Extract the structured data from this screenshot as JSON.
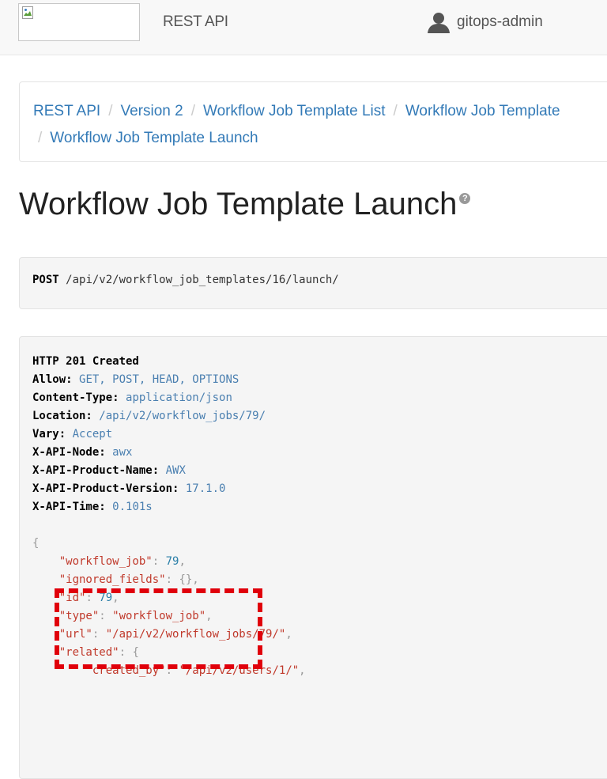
{
  "navbar": {
    "brand": "REST API",
    "username": "gitops-admin"
  },
  "breadcrumb": {
    "items": [
      "REST API",
      "Version 2",
      "Workflow Job Template List",
      "Workflow Job Template",
      "Workflow Job Template Launch"
    ]
  },
  "page": {
    "title": "Workflow Job Template Launch",
    "help_glyph": "?"
  },
  "request": {
    "method": "POST",
    "path": "/api/v2/workflow_job_templates/16/launch/"
  },
  "response": {
    "status": "HTTP 201 Created",
    "headers": [
      {
        "name": "Allow:",
        "value": "GET, POST, HEAD, OPTIONS"
      },
      {
        "name": "Content-Type:",
        "value": "application/json"
      },
      {
        "name": "Location:",
        "value": "/api/v2/workflow_jobs/79/"
      },
      {
        "name": "Vary:",
        "value": "Accept"
      },
      {
        "name": "X-API-Node:",
        "value": "awx"
      },
      {
        "name": "X-API-Product-Name:",
        "value": "AWX"
      },
      {
        "name": "X-API-Product-Version:",
        "value": "17.1.0"
      },
      {
        "name": "X-API-Time:",
        "value": "0.101s"
      }
    ],
    "body": {
      "open_brace": "{",
      "fields": [
        {
          "key": "\"workflow_job\"",
          "value": "79",
          "kind": "num",
          "trail": ","
        },
        {
          "key": "\"ignored_fields\"",
          "value": "{}",
          "kind": "punct",
          "trail": ","
        },
        {
          "key": "\"id\"",
          "value": "79",
          "kind": "num",
          "trail": ","
        },
        {
          "key": "\"type\"",
          "value": "\"workflow_job\"",
          "kind": "str",
          "trail": ","
        },
        {
          "key": "\"url\"",
          "value": "\"/api/v2/workflow_jobs/79/\"",
          "kind": "str",
          "trail": ","
        },
        {
          "key": "\"related\"",
          "value": "{",
          "kind": "punct",
          "trail": ""
        }
      ],
      "related": [
        {
          "key": "\"created_by\"",
          "value": "\"/api/v2/users/1/\"",
          "kind": "str",
          "trail": ","
        }
      ]
    }
  },
  "annotation": {
    "color": "#e0000b"
  }
}
